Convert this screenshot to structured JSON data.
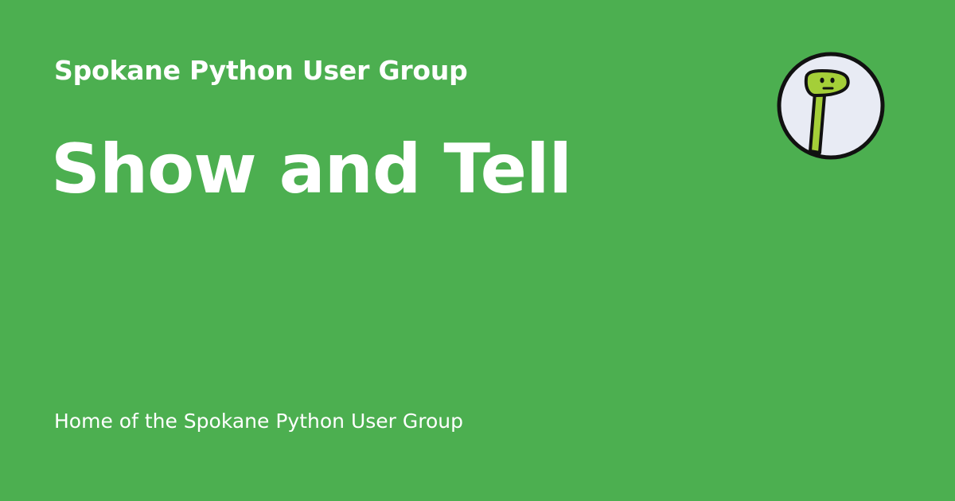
{
  "site": {
    "name": "Spokane Python User Group"
  },
  "page": {
    "title": "Show and Tell",
    "tagline": "Home of the Spokane Python User Group"
  },
  "logo": {
    "icon": "snake-mascot-icon"
  },
  "colors": {
    "background": "#4caf50",
    "text": "#ffffff",
    "logo_ring": "#111111",
    "logo_bg": "#e8ebf4",
    "snake_green": "#a4cf38"
  }
}
